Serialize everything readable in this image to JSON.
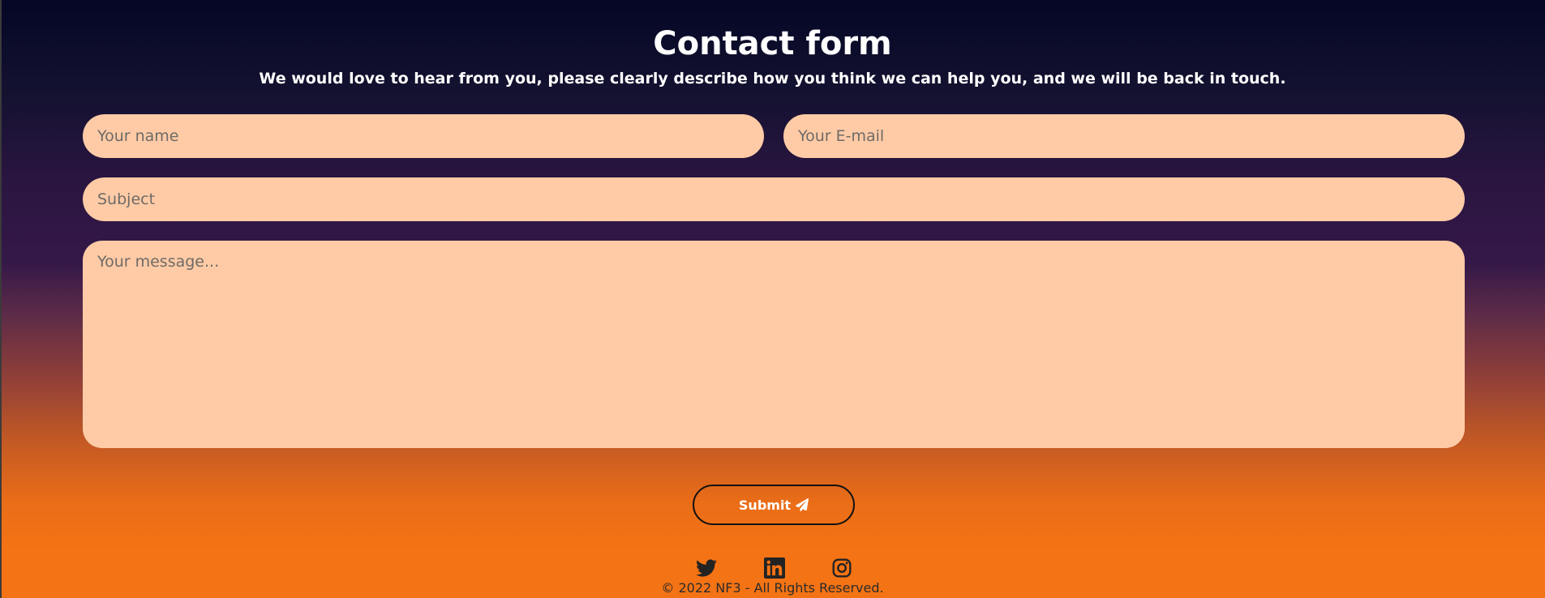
{
  "header": {
    "title": "Contact form",
    "subtitle": "We would love to hear from you, please clearly describe how you think we can help you, and we will be back in touch."
  },
  "form": {
    "name": {
      "placeholder": "Your name",
      "value": ""
    },
    "email": {
      "placeholder": "Your E-mail",
      "value": ""
    },
    "subject": {
      "placeholder": "Subject",
      "value": ""
    },
    "message": {
      "placeholder": "Your message...",
      "value": ""
    },
    "submit_label": "Submit",
    "submit_icon": "paper-plane-icon"
  },
  "footer": {
    "social": [
      {
        "icon": "twitter-icon"
      },
      {
        "icon": "linkedin-icon"
      },
      {
        "icon": "instagram-icon"
      }
    ],
    "copyright": "© 2022 NF3 - All Rights Reserved."
  },
  "colors": {
    "gradient_top": "#050626",
    "gradient_mid": "#351848",
    "gradient_bottom": "#f47314",
    "field_background": "#ffcba6",
    "text_primary": "#ffffff",
    "footer_text": "#2b2b2b"
  }
}
